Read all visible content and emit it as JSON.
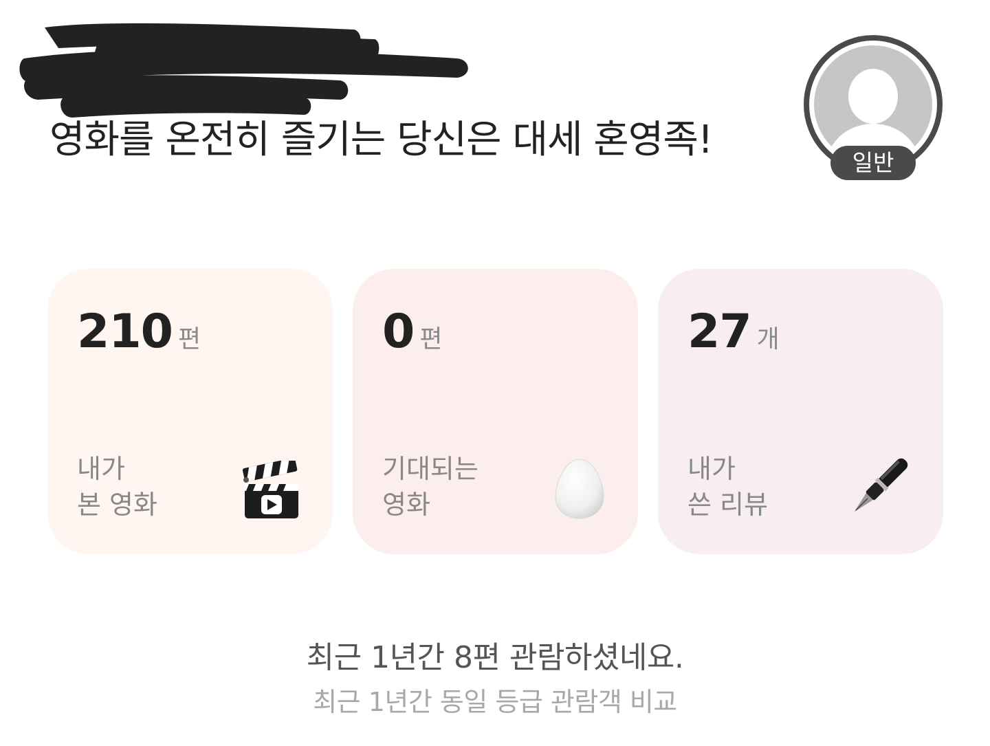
{
  "header": {
    "headline": "영화를 온전히 즐기는 당신은 대세 혼영족!"
  },
  "profile": {
    "grade_badge": "일반",
    "avatar_icon": "person-silhouette-icon"
  },
  "stats": [
    {
      "count": "210",
      "unit": "편",
      "label_line1": "내가",
      "label_line2": "본 영화",
      "icon": "clapperboard-icon"
    },
    {
      "count": "0",
      "unit": "편",
      "label_line1": "기대되는",
      "label_line2": "영화",
      "icon": "egg-icon"
    },
    {
      "count": "27",
      "unit": "개",
      "label_line1": "내가",
      "label_line2": "쓴 리뷰",
      "icon": "fountain-pen-icon"
    }
  ],
  "summary": {
    "main": "최근 1년간 8편 관람하셨네요.",
    "sub": "최근 1년간 동일 등급 관람객 비교"
  },
  "colors": {
    "card_1_bg": "#fff6f2",
    "card_2_bg": "#fdeeee",
    "card_3_bg": "#f8eeef",
    "badge_bg": "#4a4a4a"
  }
}
